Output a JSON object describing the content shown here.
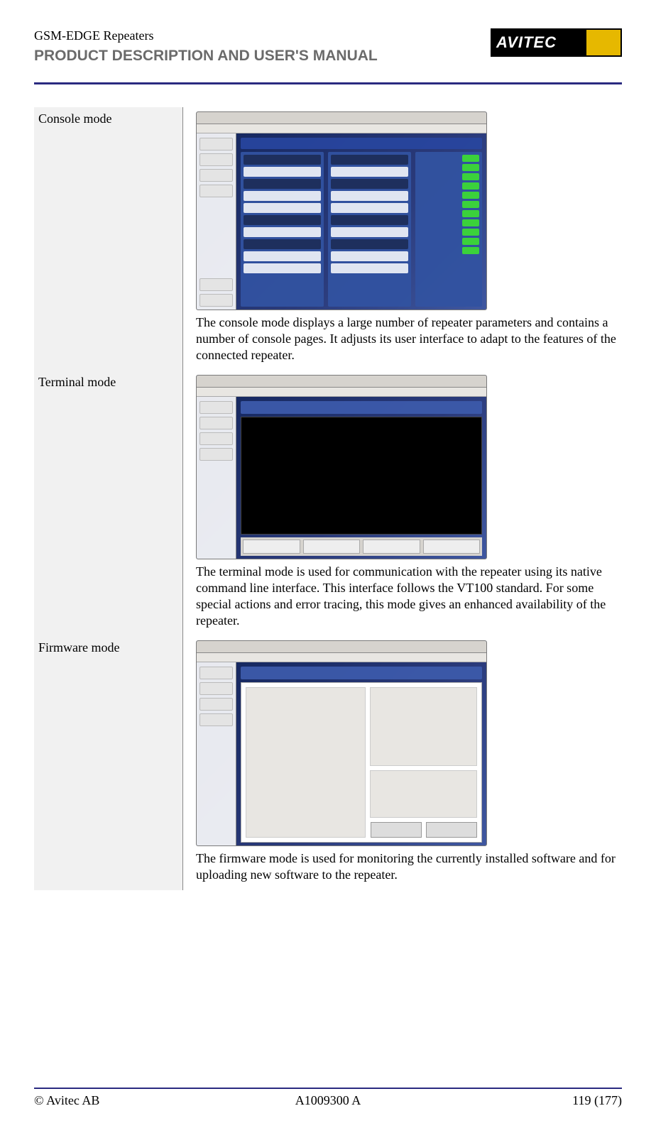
{
  "header": {
    "top": "GSM-EDGE Repeaters",
    "sub": "PRODUCT DESCRIPTION AND USER'S MANUAL",
    "logo_text": "AVITEC"
  },
  "rows": {
    "console": {
      "label": "Console mode",
      "desc": "The console mode displays a large number of repeater parameters and contains a number of console pages. It adjusts its user interface to adapt to the features of the connected repeater."
    },
    "terminal": {
      "label": "Terminal mode",
      "desc": "The terminal mode is used for communication with the repeater using its native command line interface. This interface follows the VT100 standard. For some special actions and error tracing, this mode gives an enhanced availability of the repeater."
    },
    "firmware": {
      "label": "Firmware mode",
      "desc": "The firmware mode is used for monitoring the currently installed software and for uploading new software to the repeater."
    }
  },
  "footer": {
    "left": "© Avitec AB",
    "center": "A1009300 A",
    "right": "119 (177)"
  }
}
